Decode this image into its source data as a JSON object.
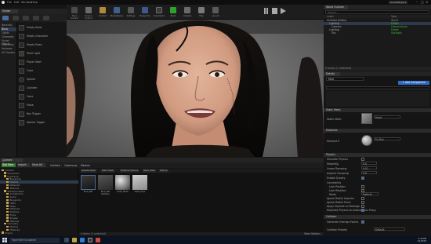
{
  "window": {
    "menu": [
      "File",
      "Edit",
      "Window",
      "Help"
    ],
    "title": "UnrealProject"
  },
  "modes": {
    "tab_label": "Modes"
  },
  "place": {
    "categories": [
      "Recently Placed",
      "Basic",
      "Lights",
      "Cinematic",
      "Visual Effects",
      "Geometry",
      "Volumes",
      "All Classes"
    ],
    "selected_index": 1,
    "items": [
      "Empty Actor",
      "Empty Character",
      "Empty Pawn",
      "Point Light",
      "Player Start",
      "Cube",
      "Sphere",
      "Cylinder",
      "Cone",
      "Plane",
      "Box Trigger",
      "Sphere Trigger"
    ]
  },
  "toolbar": {
    "buttons": [
      "Save Current",
      "Source Control",
      "Content",
      "Marketplace",
      "Settings",
      "Blueprints",
      "Cinematics",
      "Build",
      "Compile",
      "Play",
      "Launch"
    ]
  },
  "outliner": {
    "tab_label": "World Outliner",
    "search_placeholder": "Search...",
    "col_label": "Label",
    "col_type": "Type",
    "rows": [
      {
        "name": "Untitled (Editor)",
        "type": "World"
      },
      {
        "name": "Lighting",
        "type": "Folder"
      },
      {
        "name": "Camera",
        "type": "CameraActor"
      },
      {
        "name": "Lighting",
        "type": "Folder"
      },
      {
        "name": "Sky",
        "type": "SkyLight"
      }
    ],
    "footer": "5 actors (1 selected)"
  },
  "details": {
    "tab_label": "Details",
    "actor_name": "Face",
    "add_component": "+ Add Component",
    "sections": {
      "static_mesh": "Static Mesh",
      "materials": "Materials",
      "physics": "Physics",
      "collision": "Collision"
    },
    "labels": {
      "static_mesh": "Static Mesh",
      "element0": "Element 0",
      "simulate_physics": "Simulate Physics",
      "mass": "MassInKg",
      "linear_damping": "Linear Damping",
      "angular_damping": "Angular Damping",
      "enable_gravity": "Enable Gravity",
      "constraints": "Constraints",
      "lock_position": "Lock Position",
      "lock_rotation": "Lock Rotation",
      "mode": "Mode",
      "ignore_radial_impulse": "Ignore Radial Impulse",
      "ignore_radial_force": "Ignore Radial Force",
      "apply_impulse": "Apply Impulse on Damage",
      "replicate": "Replicate Physics to Autonomous Proxy",
      "gen_overlap": "Generate Overlap Events",
      "collision_presets": "Collision Presets"
    },
    "values": {
      "static_mesh": "Head",
      "element0": "M_Skin",
      "mass": "0.0",
      "linear_damping": "0.01",
      "angular_damping": "0.0",
      "mode": "Default",
      "collision_presets": "Default"
    }
  },
  "content": {
    "tab_label": "Content Browser",
    "add_new": "Add New",
    "import": "Import",
    "save_all": "Save All",
    "breadcrumbs": [
      "Content",
      "Cyberscrp",
      "Meshes"
    ],
    "filters": [
      "Skeletal Mesh",
      "Static Mesh",
      "Material Instance",
      "Static Mesh",
      "Texture"
    ],
    "tree": [
      "Content",
      "Characters",
      "Cyberscrp",
      "Blueprints",
      "Meshes",
      "Materials",
      "Textures",
      "StarterContent",
      "Architecture",
      "Audio",
      "Blueprints",
      "HDRI",
      "Maps",
      "Materials",
      "Particles",
      "Props",
      "Shapes",
      "Textures",
      "Geometry",
      "Meshes",
      "Materials",
      "Engine"
    ],
    "selected_tree_index": 4,
    "assets": [
      {
        "label": "Face_Mat",
        "kind": "material-dark"
      },
      {
        "label": "Face_Mat Skeleton",
        "kind": "skeleton"
      },
      {
        "label": "Head_Mesh",
        "kind": "sphere"
      },
      {
        "label": "Head_Phys",
        "kind": "mesh-light"
      }
    ],
    "status": "4 items (1 selected)",
    "view_options": "View Options"
  },
  "taskbar": {
    "search_placeholder": "Type here to search",
    "time": "2:18 PM",
    "date": "1/1/2018"
  },
  "colors": {
    "accent": "#2e6ec9",
    "selection": "#2e3a4c",
    "outliner_type": "#3ec03e",
    "folder": "#c9a44b"
  }
}
